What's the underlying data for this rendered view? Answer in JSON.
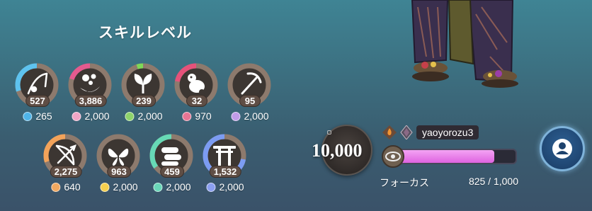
{
  "skills_panel": {
    "title": "スキルレベル",
    "skills": [
      {
        "icon": "fishing-rod-icon",
        "level": "527",
        "resource": "265",
        "ring_color": "#5ec3ef",
        "ring_fraction": 0.3,
        "resource_color": "#4fb4e8"
      },
      {
        "icon": "bubbles-icon",
        "level": "3,886",
        "resource": "2,000",
        "ring_color": "#e55a8f",
        "ring_fraction": 0.2,
        "resource_color": "#f0a5c6"
      },
      {
        "icon": "leaves-icon",
        "level": "239",
        "resource": "2,000",
        "ring_color": "#7ed957",
        "ring_fraction": 0.05,
        "resource_color": "#8ed36b"
      },
      {
        "icon": "creature-icon",
        "level": "32",
        "resource": "970",
        "ring_color": "#e5527a",
        "ring_fraction": 0.22,
        "resource_color": "#e87594"
      },
      {
        "icon": "pickaxe-icon",
        "level": "95",
        "resource": "2,000",
        "ring_color": "#b690e0",
        "ring_fraction": 0.0,
        "resource_color": "#c19be8"
      },
      {
        "icon": "bow-arrow-icon",
        "level": "2,275",
        "resource": "640",
        "ring_color": "#f3a35a",
        "ring_fraction": 0.3,
        "resource_color": "#f0a860"
      },
      {
        "icon": "butterfly-icon",
        "level": "963",
        "resource": "2,000",
        "ring_color": "#f5d35c",
        "ring_fraction": 0.0,
        "resource_color": "#f5cf4e"
      },
      {
        "icon": "logs-icon",
        "level": "459",
        "resource": "2,000",
        "ring_color": "#67d9b5",
        "ring_fraction": 0.35,
        "resource_color": "#6ad6b8"
      },
      {
        "icon": "torii-icon",
        "level": "1,532",
        "resource": "2,000",
        "ring_color": "#7c9cf2",
        "ring_fraction": 0.72,
        "resource_color": "#8b9ff0"
      }
    ]
  },
  "focus_panel": {
    "value": "10,000",
    "player_name": "yaoyorozu3",
    "label": "フォーカス",
    "count": "825 / 1,000",
    "fill_fraction": 0.825,
    "fill_color": "#e26ae2"
  },
  "icons": {
    "flame": "flame-icon",
    "rank": "rank-diamond-icon",
    "eye": "eye-icon",
    "profile": "person-icon"
  }
}
